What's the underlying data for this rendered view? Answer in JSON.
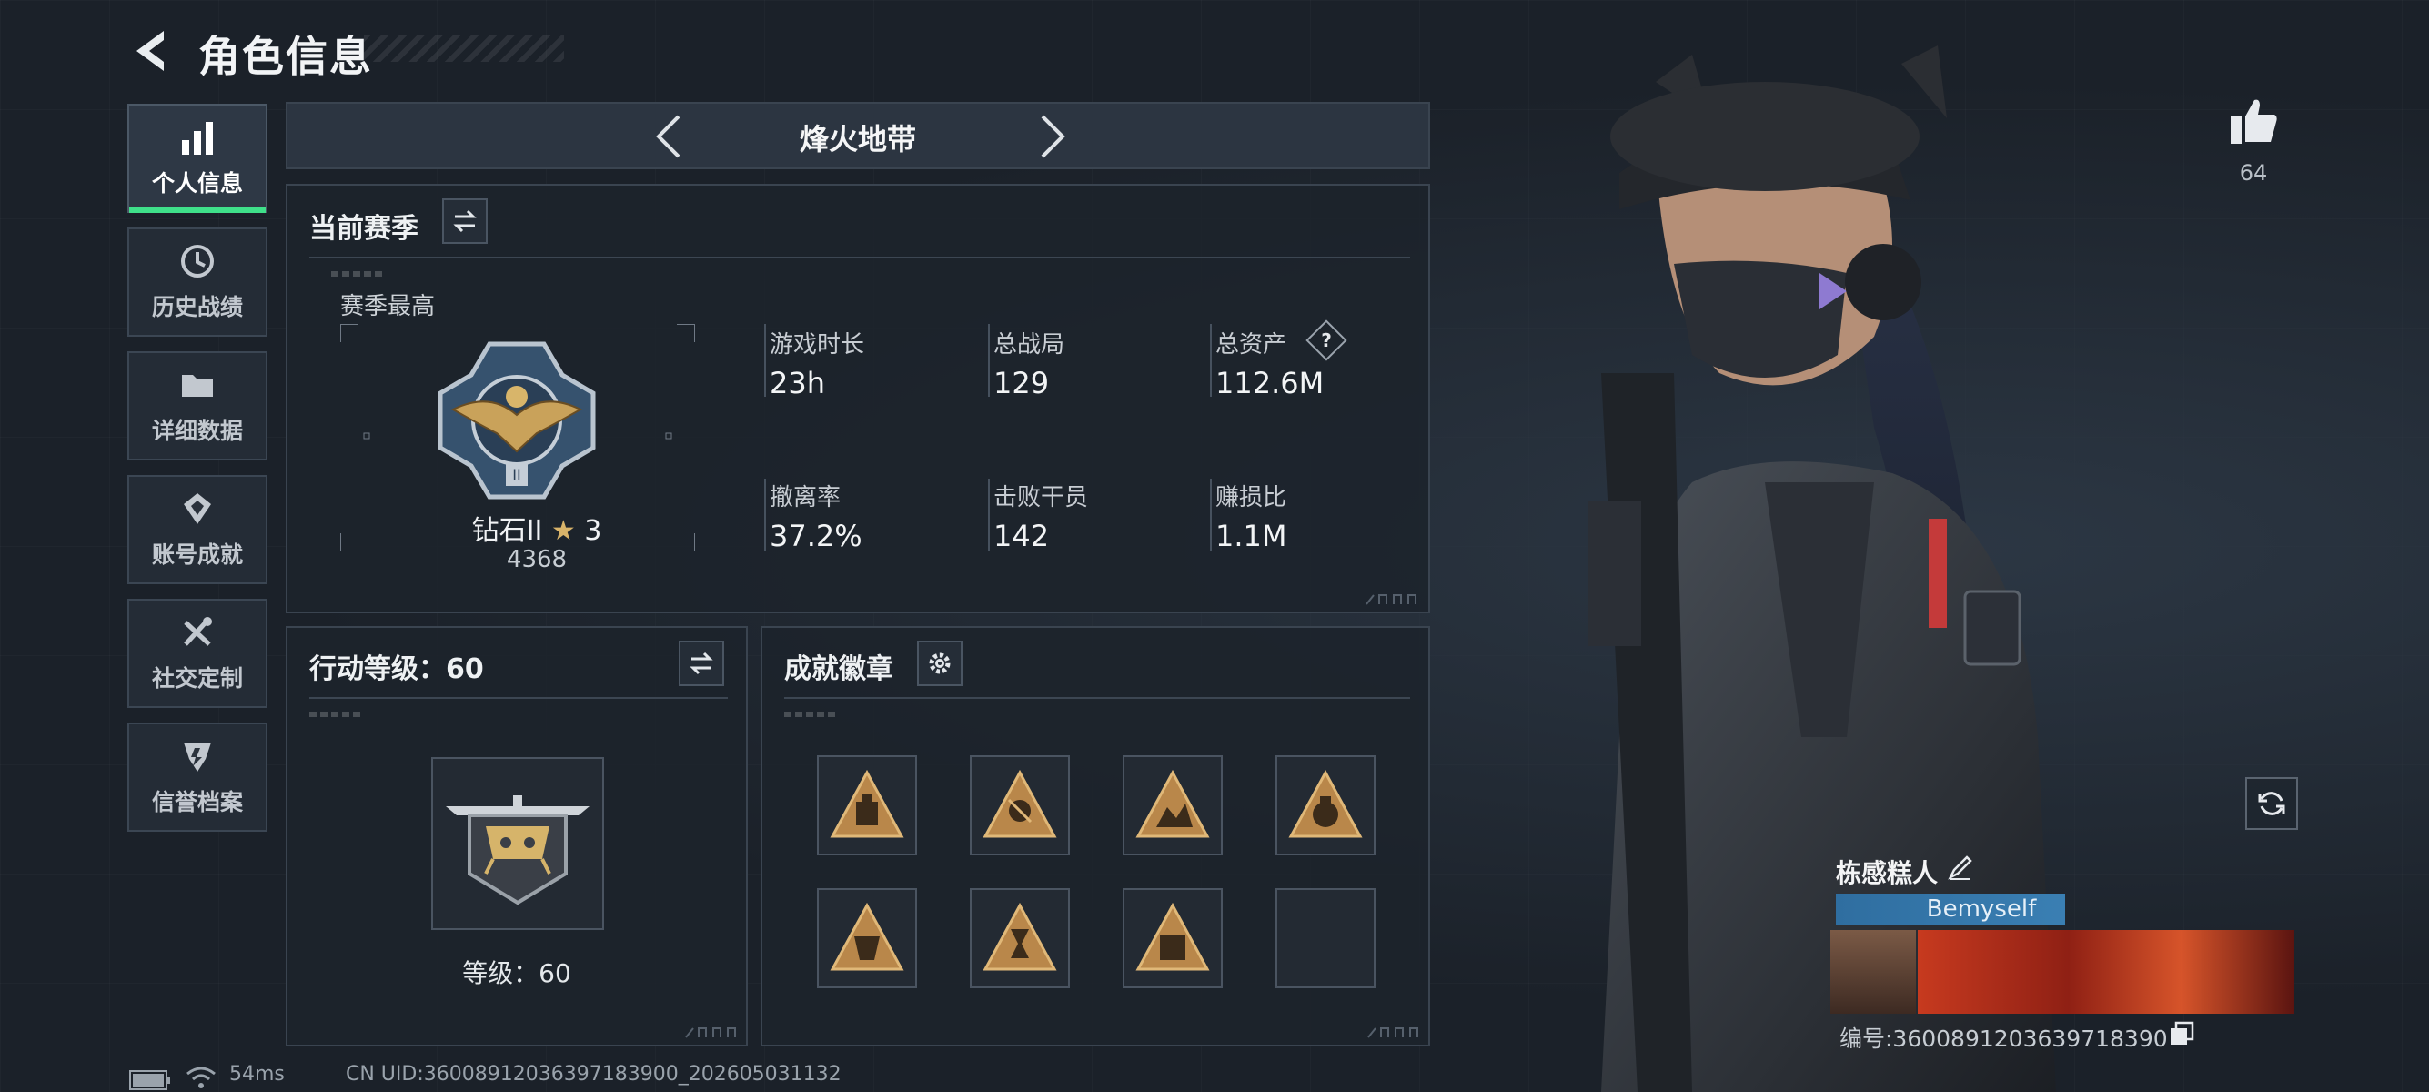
{
  "header": {
    "title": "角色信息"
  },
  "sidebar": {
    "items": [
      {
        "label": "个人信息",
        "icon": "bar-chart-icon",
        "active": true
      },
      {
        "label": "历史战绩",
        "icon": "history-icon",
        "active": false
      },
      {
        "label": "详细数据",
        "icon": "folder-icon",
        "active": false
      },
      {
        "label": "账号成就",
        "icon": "achievement-icon",
        "active": false
      },
      {
        "label": "社交定制",
        "icon": "tools-icon",
        "active": false
      },
      {
        "label": "信誉档案",
        "icon": "credit-icon",
        "active": false
      }
    ]
  },
  "mode": {
    "name": "烽火地带"
  },
  "season": {
    "title": "当前赛季",
    "best_label": "赛季最高",
    "rank_name": "钻石II",
    "rank_stars": "3",
    "rank_score": "4368",
    "stats": [
      {
        "label": "游戏时长",
        "value": "23h"
      },
      {
        "label": "总战局",
        "value": "129"
      },
      {
        "label": "总资产",
        "value": "112.6M"
      },
      {
        "label": "撤离率",
        "value": "37.2%"
      },
      {
        "label": "击败干员",
        "value": "142"
      },
      {
        "label": "赚损比",
        "value": "1.1M"
      }
    ],
    "help_label": "?"
  },
  "level": {
    "title": "行动等级：60",
    "level_text": "等级：60"
  },
  "achievements": {
    "title": "成就徽章",
    "badges": [
      "badge-1",
      "badge-2",
      "badge-3",
      "badge-4",
      "badge-5",
      "badge-6",
      "badge-7",
      "empty"
    ]
  },
  "profile": {
    "likes": "64",
    "name": "栋感糕人",
    "tag": "Bemyself",
    "uid": "编号:3600891203639718390"
  },
  "footer": {
    "ping": "54ms",
    "uid": "CN UID:36008912036397183900_202605031132"
  },
  "colors": {
    "accent": "#3fe08a",
    "panel": "#1c232b",
    "gold": "#c9a25a",
    "border": "#3a4450"
  }
}
